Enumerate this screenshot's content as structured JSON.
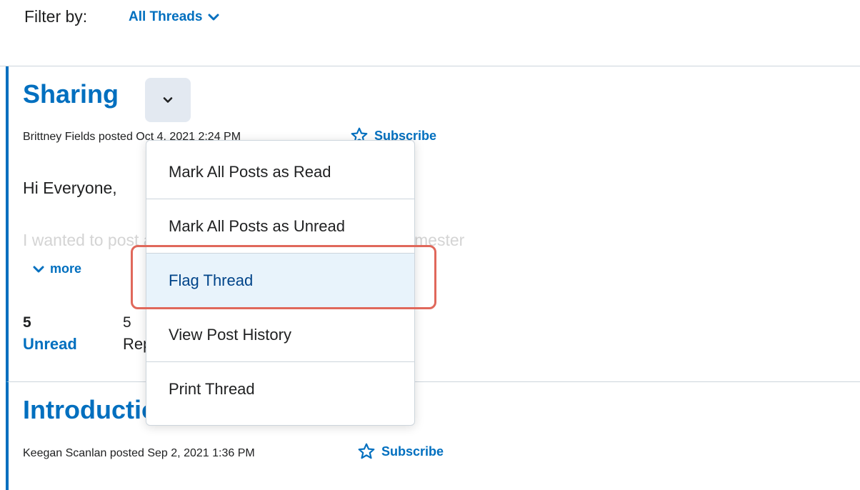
{
  "filter": {
    "label": "Filter by:",
    "value": "All Threads",
    "icon": "chevron-down-icon"
  },
  "threads": [
    {
      "title": "Sharing",
      "meta": "Brittney Fields posted Oct 4, 2021 2:24 PM",
      "subscribe_label": "Subscribe",
      "greeting": "Hi Everyone,",
      "body_preview": "I wanted to post about the question. This is my first semester",
      "more_label": "more",
      "unread_count": "5",
      "unread_label": "Unread",
      "replies_count": "5",
      "replies_label": "Replies"
    },
    {
      "title": "Introductions",
      "meta": "Keegan Scanlan posted Sep 2, 2021 1:36 PM",
      "subscribe_label": "Subscribe"
    }
  ],
  "menu": {
    "items": [
      "Mark All Posts as Read",
      "Mark All Posts as Unread",
      "Flag Thread",
      "View Post History",
      "Print Thread"
    ],
    "highlighted_item": "Flag Thread"
  },
  "colors": {
    "accent": "#006fbf",
    "thread_border": "#006fbf",
    "menu_highlight_bg": "#e8f3fb",
    "callout": "#e0685b"
  }
}
